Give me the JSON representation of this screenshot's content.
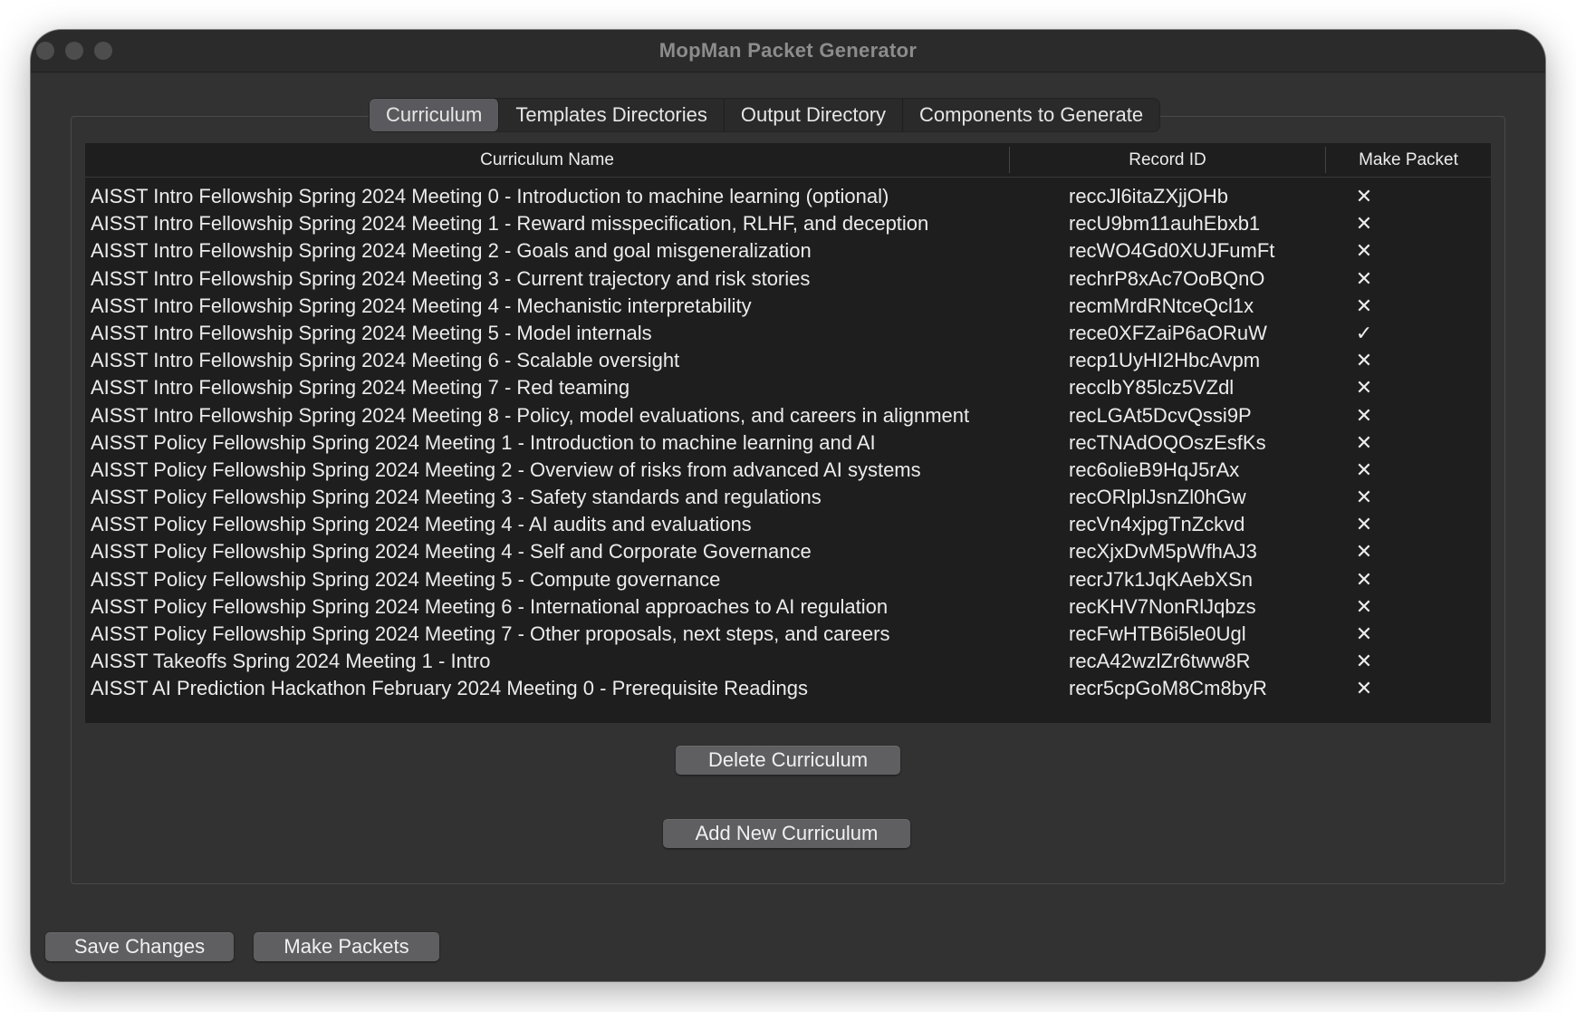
{
  "window": {
    "title": "MopMan Packet Generator"
  },
  "tabs": [
    {
      "label": "Curriculum",
      "active": true
    },
    {
      "label": "Templates Directories",
      "active": false
    },
    {
      "label": "Output Directory",
      "active": false
    },
    {
      "label": "Components to Generate",
      "active": false
    }
  ],
  "table": {
    "headers": {
      "name": "Curriculum Name",
      "record_id": "Record ID",
      "make_packet": "Make Packet"
    },
    "rows": [
      {
        "name": "AISST Intro Fellowship Spring 2024 Meeting 0 - Introduction to machine learning (optional)",
        "record_id": "reccJl6itaZXjjOHb",
        "make_packet": "✕"
      },
      {
        "name": "AISST Intro Fellowship Spring 2024 Meeting 1 - Reward misspecification, RLHF, and deception",
        "record_id": "recU9bm11auhEbxb1",
        "make_packet": "✕"
      },
      {
        "name": "AISST Intro Fellowship Spring 2024 Meeting 2 - Goals and goal misgeneralization",
        "record_id": "recWO4Gd0XUJFumFt",
        "make_packet": "✕"
      },
      {
        "name": "AISST Intro Fellowship Spring 2024 Meeting 3 - Current trajectory and risk stories",
        "record_id": "rechrP8xAc7OoBQnO",
        "make_packet": "✕"
      },
      {
        "name": "AISST Intro Fellowship Spring 2024 Meeting 4 - Mechanistic interpretability",
        "record_id": "recmMrdRNtceQcl1x",
        "make_packet": "✕"
      },
      {
        "name": "AISST Intro Fellowship Spring 2024 Meeting 5 - Model internals",
        "record_id": "rece0XFZaiP6aORuW",
        "make_packet": "✓"
      },
      {
        "name": "AISST Intro Fellowship Spring 2024 Meeting 6 - Scalable oversight",
        "record_id": "recp1UyHI2HbcAvpm",
        "make_packet": "✕"
      },
      {
        "name": "AISST Intro Fellowship Spring 2024 Meeting 7 - Red teaming",
        "record_id": "recclbY85lcz5VZdl",
        "make_packet": "✕"
      },
      {
        "name": "AISST Intro Fellowship Spring 2024 Meeting 8 - Policy, model evaluations, and careers in alignment",
        "record_id": "recLGAt5DcvQssi9P",
        "make_packet": "✕"
      },
      {
        "name": "AISST Policy Fellowship Spring 2024 Meeting 1 - Introduction to machine learning and AI",
        "record_id": "recTNAdOQOszEsfKs",
        "make_packet": "✕"
      },
      {
        "name": "AISST Policy Fellowship Spring 2024 Meeting 2 - Overview of risks from advanced AI systems",
        "record_id": "rec6olieB9HqJ5rAx",
        "make_packet": "✕"
      },
      {
        "name": "AISST Policy Fellowship Spring 2024 Meeting 3 - Safety standards and regulations",
        "record_id": "recORlplJsnZl0hGw",
        "make_packet": "✕"
      },
      {
        "name": "AISST Policy Fellowship Spring 2024 Meeting 4 - AI audits and evaluations",
        "record_id": "recVn4xjpgTnZckvd",
        "make_packet": "✕"
      },
      {
        "name": "AISST Policy Fellowship Spring 2024 Meeting 4 - Self and Corporate Governance",
        "record_id": "recXjxDvM5pWfhAJ3",
        "make_packet": "✕"
      },
      {
        "name": "AISST Policy Fellowship Spring 2024 Meeting 5 - Compute governance",
        "record_id": "recrJ7k1JqKAebXSn",
        "make_packet": "✕"
      },
      {
        "name": "AISST Policy Fellowship Spring 2024 Meeting 6 - International approaches to AI regulation",
        "record_id": "recKHV7NonRlJqbzs",
        "make_packet": "✕"
      },
      {
        "name": "AISST Policy Fellowship Spring 2024 Meeting 7 - Other proposals, next steps, and careers",
        "record_id": "recFwHTB6i5le0Ugl",
        "make_packet": "✕"
      },
      {
        "name": "AISST Takeoffs Spring 2024 Meeting 1 - Intro",
        "record_id": "recA42wzlZr6tww8R",
        "make_packet": "✕"
      },
      {
        "name": "AISST AI Prediction Hackathon February 2024 Meeting 0 - Prerequisite Readings",
        "record_id": "recr5cpGoM8Cm8byR",
        "make_packet": "✕"
      }
    ]
  },
  "buttons": {
    "delete_curriculum": "Delete Curriculum",
    "add_new_curriculum": "Add New Curriculum",
    "save_changes": "Save Changes",
    "make_packets": "Make Packets"
  }
}
